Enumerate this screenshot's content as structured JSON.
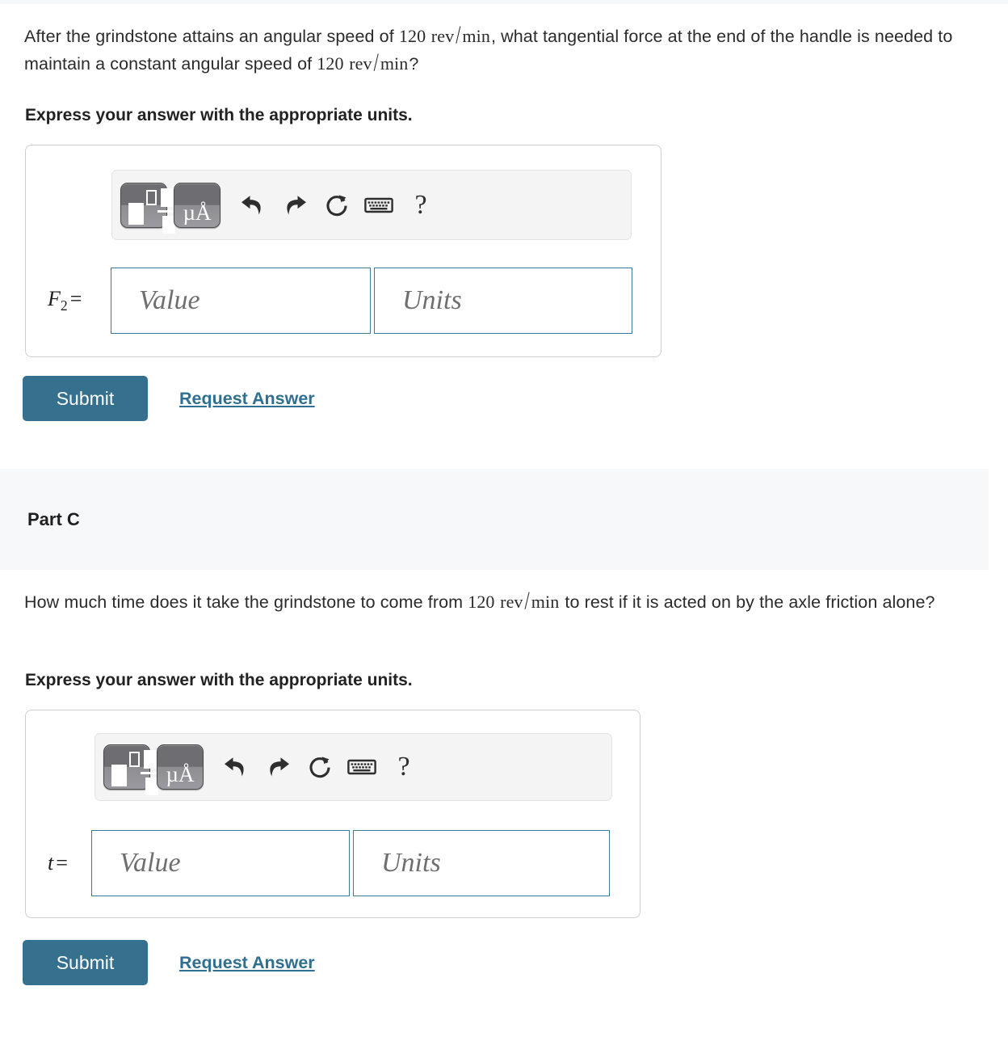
{
  "part_b": {
    "question_prefix": "After the grindstone attains an angular speed of ",
    "question_value_1": "120",
    "question_unit_num": "rev",
    "question_unit_slash": "/",
    "question_unit_den": "min",
    "question_middle": ", what tangential force at the end of the handle is needed to maintain a constant angular speed of ",
    "question_value_2": "120",
    "question_unit2_num": "rev",
    "question_unit2_slash": "/",
    "question_unit2_den": "min",
    "question_suffix": "?",
    "instruction": "Express your answer with the appropriate units.",
    "variable": "F",
    "variable_sub": "2",
    "equals": "=",
    "value_placeholder": "Value",
    "units_placeholder": "Units",
    "submit_label": "Submit",
    "request_answer_label": "Request Answer"
  },
  "part_c": {
    "header": "Part C",
    "question_prefix": "How much time does it take the grindstone to come from ",
    "question_value_1": "120",
    "question_unit_num": "rev",
    "question_unit_slash": "/",
    "question_unit_den": "min",
    "question_suffix": " to rest if it is acted on by the axle friction alone?",
    "instruction": "Express your answer with the appropriate units.",
    "variable": "t",
    "equals": "=",
    "value_placeholder": "Value",
    "units_placeholder": "Units",
    "submit_label": "Submit",
    "request_answer_label": "Request Answer"
  },
  "toolbar": {
    "templates_icon": "math-templates-icon",
    "units_icon": "micro-angstrom-units-icon",
    "units_label": "µÅ",
    "undo_icon": "undo-arrow-icon",
    "redo_icon": "redo-arrow-icon",
    "reset_icon": "reset-circular-arrow-icon",
    "keyboard_icon": "keyboard-icon",
    "help_icon": "help-question-mark-icon",
    "help_label": "?"
  },
  "colors": {
    "submit_background": "#35718f",
    "link": "#2f6f91",
    "field_border": "#3c7b96",
    "band_background": "#f7f8f9",
    "card_border": "#cfcfcf"
  }
}
